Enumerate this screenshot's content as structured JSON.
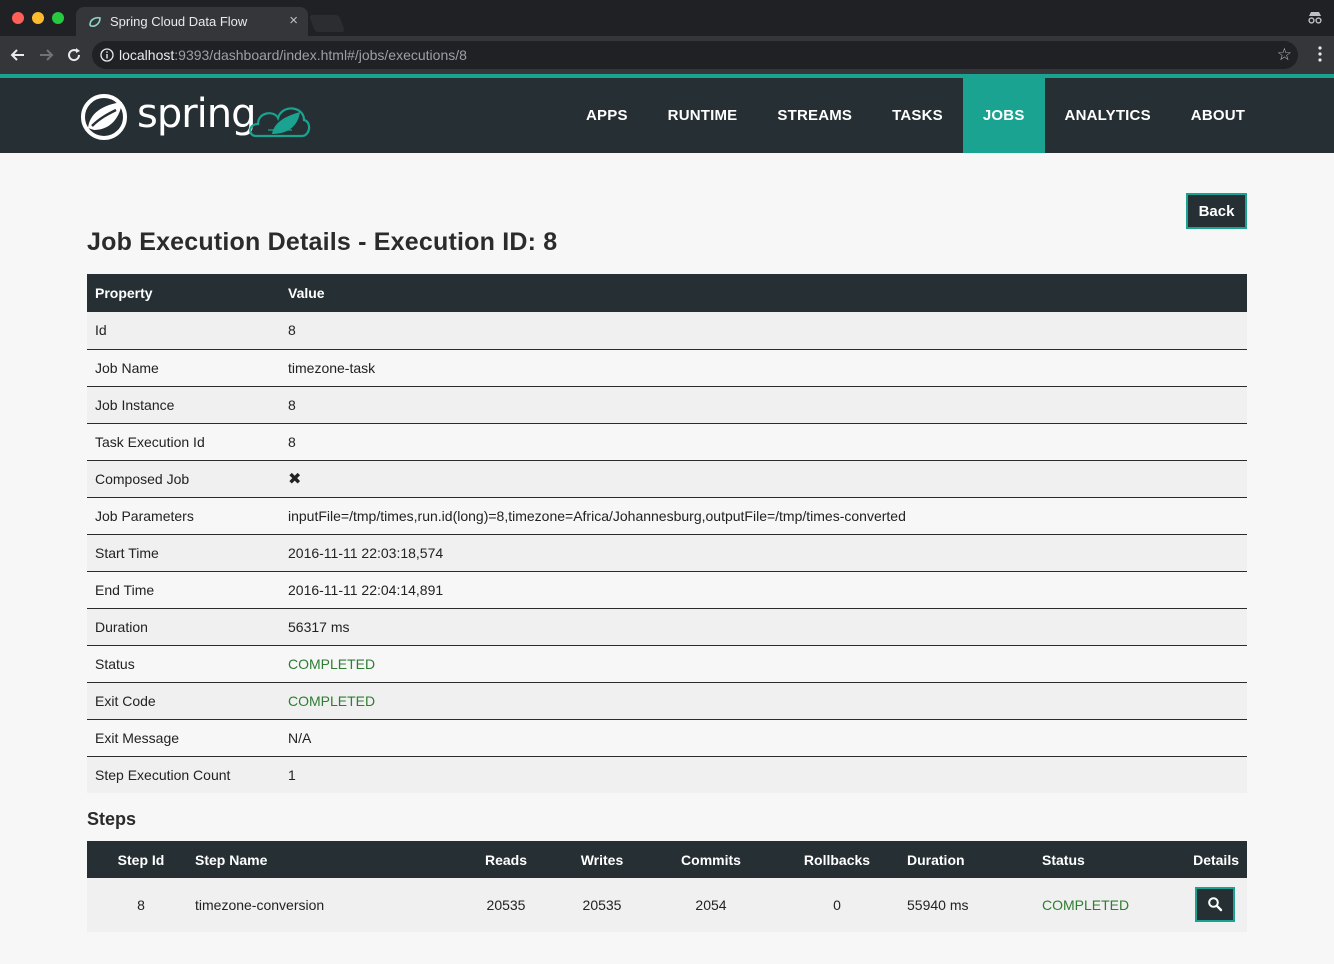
{
  "browser": {
    "tab_title": "Spring Cloud Data Flow",
    "tab_close": "×",
    "url_host": "localhost",
    "url_path": ":9393/dashboard/index.html#/jobs/executions/8",
    "bookmark_star": "☆"
  },
  "brand": {
    "logo_text": "spring",
    "accent_color": "#1aa391",
    "navbar_color": "#262f33"
  },
  "nav": {
    "items": [
      {
        "label": "APPS"
      },
      {
        "label": "RUNTIME"
      },
      {
        "label": "STREAMS"
      },
      {
        "label": "TASKS"
      },
      {
        "label": "JOBS",
        "active": true
      },
      {
        "label": "ANALYTICS"
      },
      {
        "label": "ABOUT"
      }
    ]
  },
  "page": {
    "back_label": "Back",
    "title": "Job Execution Details - Execution ID: 8"
  },
  "properties": {
    "headers": {
      "property": "Property",
      "value": "Value"
    },
    "rows": [
      {
        "property": "Id",
        "value": "8"
      },
      {
        "property": "Job Name",
        "value": "timezone-task"
      },
      {
        "property": "Job Instance",
        "value": "8"
      },
      {
        "property": "Task Execution Id",
        "value": "8"
      },
      {
        "property": "Composed Job",
        "value": "✖"
      },
      {
        "property": "Job Parameters",
        "value": "inputFile=/tmp/times,run.id(long)=8,timezone=Africa/Johannesburg,outputFile=/tmp/times-converted"
      },
      {
        "property": "Start Time",
        "value": "2016-11-11 22:03:18,574"
      },
      {
        "property": "End Time",
        "value": "2016-11-11 22:04:14,891"
      },
      {
        "property": "Duration",
        "value": "56317 ms"
      },
      {
        "property": "Status",
        "value": "COMPLETED"
      },
      {
        "property": "Exit Code",
        "value": "COMPLETED"
      },
      {
        "property": "Exit Message",
        "value": "N/A"
      },
      {
        "property": "Step Execution Count",
        "value": "1"
      }
    ]
  },
  "steps": {
    "title": "Steps",
    "headers": {
      "step_id": "Step Id",
      "step_name": "Step Name",
      "reads": "Reads",
      "writes": "Writes",
      "commits": "Commits",
      "rollbacks": "Rollbacks",
      "duration": "Duration",
      "status": "Status",
      "details": "Details"
    },
    "rows": [
      {
        "step_id": "8",
        "step_name": "timezone-conversion",
        "reads": "20535",
        "writes": "20535",
        "commits": "2054",
        "rollbacks": "0",
        "duration": "55940 ms",
        "status": "COMPLETED",
        "details_icon": "search-icon"
      }
    ]
  },
  "status_color": "#2e7d32"
}
